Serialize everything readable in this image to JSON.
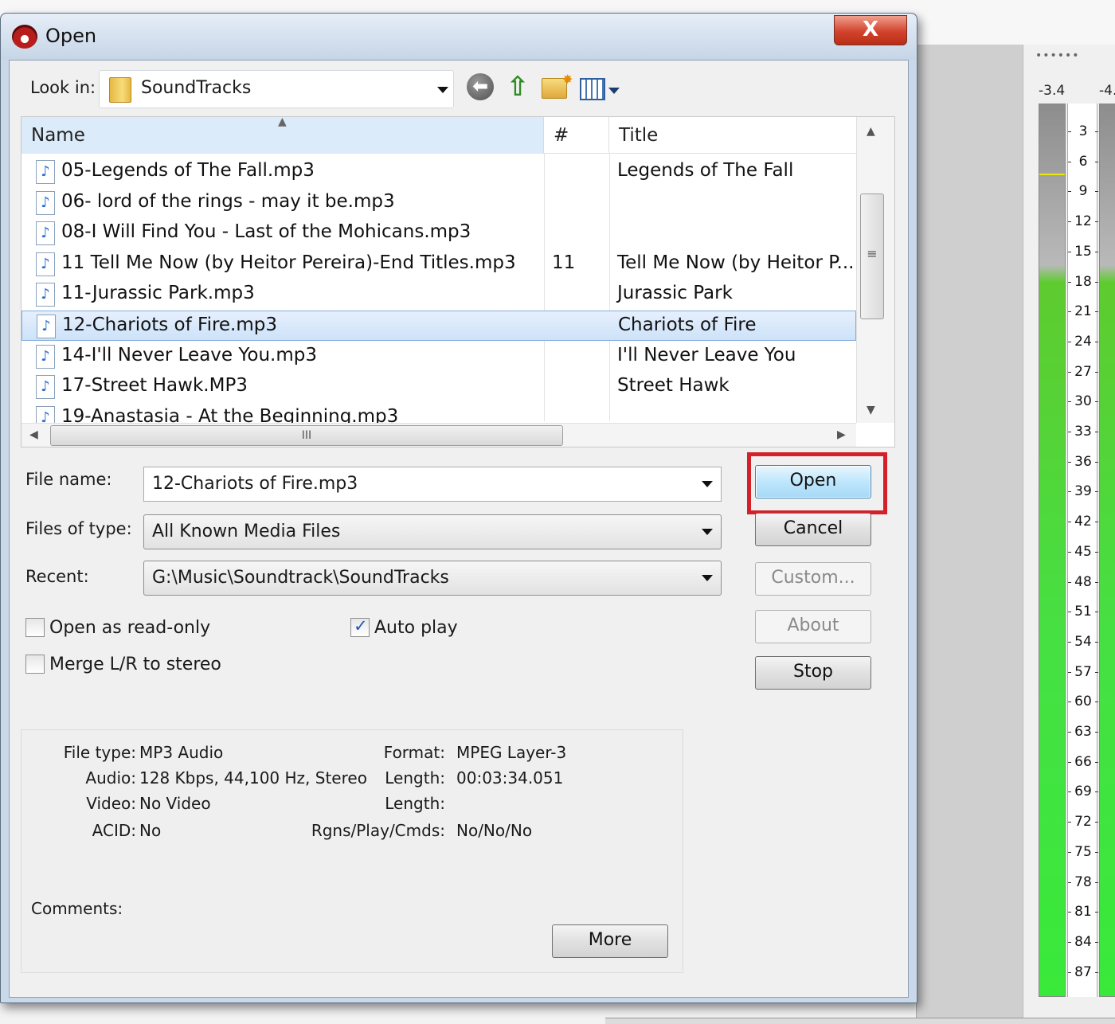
{
  "dialog": {
    "title": "Open",
    "close_label": "X"
  },
  "toolbar": {
    "look_in_label": "Look in:",
    "look_in_value": "SoundTracks"
  },
  "file_list": {
    "columns": [
      "Name",
      "#",
      "Title"
    ],
    "rows": [
      {
        "name": "05-Legends of The Fall.mp3",
        "num": "",
        "title": "Legends of The Fall"
      },
      {
        "name": "06- lord of the rings - may it be.mp3",
        "num": "",
        "title": ""
      },
      {
        "name": "08-I Will Find You - Last of the Mohicans.mp3",
        "num": "",
        "title": ""
      },
      {
        "name": "11 Tell Me Now (by Heitor Pereira)-End Titles.mp3",
        "num": "11",
        "title": "Tell Me Now (by Heitor P..."
      },
      {
        "name": "11-Jurassic Park.mp3",
        "num": "",
        "title": "Jurassic Park"
      },
      {
        "name": "12-Chariots of Fire.mp3",
        "num": "",
        "title": "Chariots of Fire",
        "selected": true
      },
      {
        "name": "14-I'll Never Leave You.mp3",
        "num": "",
        "title": "I'll Never Leave You"
      },
      {
        "name": "17-Street Hawk.MP3",
        "num": "",
        "title": "Street Hawk"
      },
      {
        "name": "19-Anastasia - At the Beginning.mp3",
        "num": "",
        "title": ""
      }
    ]
  },
  "form": {
    "file_name_label": "File name:",
    "file_name_value": "12-Chariots of Fire.mp3",
    "files_of_type_label": "Files of type:",
    "files_of_type_value": "All Known Media Files",
    "recent_label": "Recent:",
    "recent_value": "G:\\Music\\Soundtrack\\SoundTracks",
    "open_read_only_label": "Open as read-only",
    "open_read_only_checked": false,
    "auto_play_label": "Auto play",
    "auto_play_checked": true,
    "merge_lr_label": "Merge L/R to stereo",
    "merge_lr_checked": false
  },
  "buttons": {
    "open": "Open",
    "cancel": "Cancel",
    "custom": "Custom...",
    "about": "About",
    "stop": "Stop",
    "more": "More"
  },
  "info": {
    "file_type_label": "File type:",
    "file_type_value": "MP3 Audio",
    "audio_label": "Audio:",
    "audio_value": "128 Kbps, 44,100 Hz, Stereo",
    "video_label": "Video:",
    "video_value": "No Video",
    "acid_label": "ACID:",
    "acid_value": "No",
    "format_label": "Format:",
    "format_value": "MPEG Layer-3",
    "length_label": "Length:",
    "length_value": "00:03:34.051",
    "length2_label": "Length:",
    "rgns_label": "Rgns/Play/Cmds:",
    "rgns_value": "No/No/No",
    "comments_label": "Comments:"
  },
  "meter": {
    "dots": "••••••",
    "left_peak": "-3.4",
    "right_peak": "-4.",
    "scale": [
      "3",
      "6",
      "9",
      "12",
      "15",
      "18",
      "21",
      "24",
      "27",
      "30",
      "33",
      "36",
      "39",
      "42",
      "45",
      "48",
      "51",
      "54",
      "57",
      "60",
      "63",
      "66",
      "69",
      "72",
      "75",
      "78",
      "81",
      "84",
      "87"
    ]
  },
  "colors": {
    "highlight": "#d4202a",
    "meter_green": "#46e043",
    "selection": "#cde2fa"
  }
}
